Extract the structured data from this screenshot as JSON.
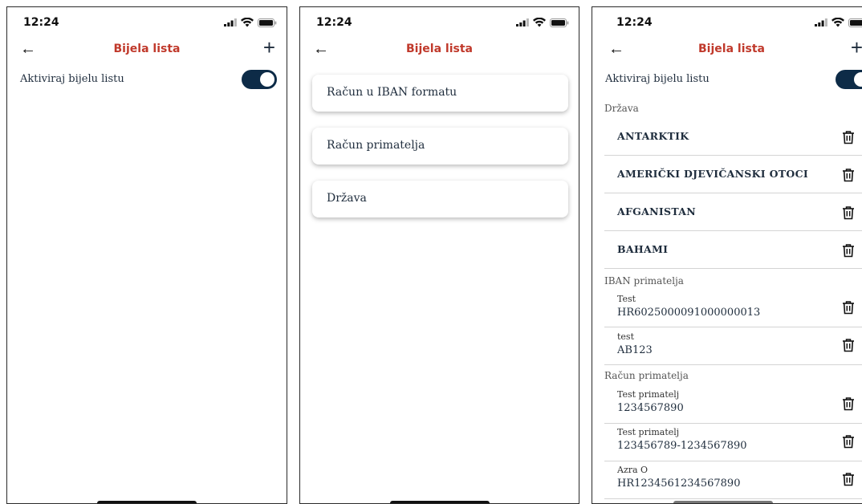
{
  "status": {
    "time": "12:24"
  },
  "header": {
    "title": "Bijela lista",
    "back_icon": "arrow-left-icon",
    "add_icon": "plus-icon"
  },
  "toggle_label": "Aktiviraj bijelu listu",
  "menu": [
    "Račun u IBAN formatu",
    "Račun primatelja",
    "Država"
  ],
  "drzava": {
    "label": "Država",
    "items": [
      "ANTARKTIK",
      "AMERIČKI DJEVIČANSKI OTOCI",
      "AFGANISTAN",
      "BAHAMI"
    ]
  },
  "iban": {
    "label": "IBAN primatelja",
    "items": [
      {
        "name": "Test",
        "value": "HR6025000091000000013"
      },
      {
        "name": "test",
        "value": "AB123"
      }
    ]
  },
  "racun": {
    "label": "Račun primatelja",
    "items": [
      {
        "name": "Test primatelj",
        "value": "1234567890"
      },
      {
        "name": "Test primatelj",
        "value": "123456789-1234567890"
      },
      {
        "name": "Azra O",
        "value": "HR1234561234567890"
      }
    ]
  },
  "colors": {
    "title": "#c0392b",
    "toggle": "#0d2b47",
    "text": "#1f2d3d"
  }
}
